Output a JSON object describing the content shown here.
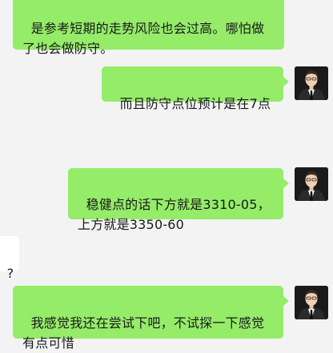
{
  "messages": [
    {
      "id": "m1",
      "text": "是参考短期的走势风险也会过高。哪怕做\n了也会做防守。",
      "side": "right",
      "color": "#95ec69"
    },
    {
      "id": "m2",
      "text": "而且防守点位预计是在7点",
      "side": "right",
      "color": "#95ec69"
    },
    {
      "id": "m3",
      "text": "稳健点的话下方就是3310-05，\n上方就是3350-60",
      "side": "right",
      "color": "#95ec69"
    },
    {
      "id": "m4",
      "text": "?",
      "side": "left",
      "color": "#ffffff"
    },
    {
      "id": "m5",
      "text": "我感觉我还在尝试下吧，不试探一下感觉\n有点可惜",
      "side": "right",
      "color": "#95ec69"
    }
  ],
  "avatar": {
    "icon": "user-avatar-icon"
  },
  "colors": {
    "background": "#f3f3f3",
    "sent_bubble": "#95ec69",
    "received_bubble": "#ffffff"
  }
}
